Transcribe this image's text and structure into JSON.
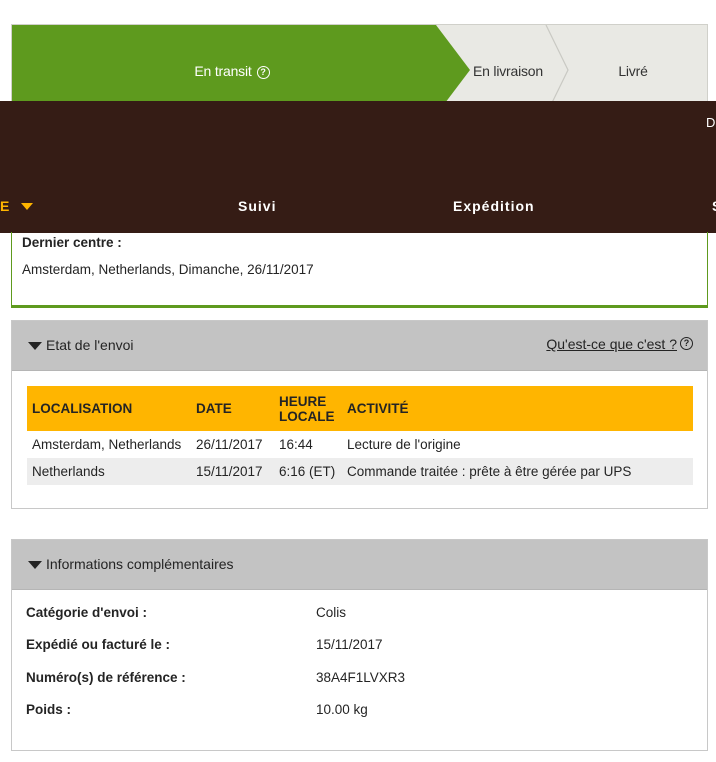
{
  "progress": {
    "steps": [
      {
        "label": "En transit",
        "help": "?"
      },
      {
        "label": "En livraison"
      },
      {
        "label": "Livré"
      }
    ],
    "colors": {
      "active": "#5e9a1e",
      "inactive": "#e9e9e4"
    }
  },
  "nav": {
    "left_label": "E",
    "corner_label": "D",
    "items": [
      "Suivi",
      "Expédition"
    ],
    "right_partial": "S",
    "bg_color": "#351c15",
    "accent_color": "#ffb500"
  },
  "summary": {
    "last_center_label": "Dernier centre :",
    "last_center_value": "Amsterdam, Netherlands, Dimanche, 26/11/2017"
  },
  "status_panel": {
    "title": "Etat de l'envoi",
    "help_link": "Qu'est-ce que c'est ?",
    "help_icon": "?",
    "columns": [
      "LOCALISATION",
      "DATE",
      "HEURE LOCALE",
      "ACTIVITÉ"
    ],
    "rows": [
      [
        "Amsterdam, Netherlands",
        "26/11/2017",
        "16:44",
        "Lecture de l'origine"
      ],
      [
        "Netherlands",
        "15/11/2017",
        "6:16 (ET)",
        "Commande traitée : prête à être gérée par UPS"
      ]
    ]
  },
  "info_panel": {
    "title": "Informations complémentaires",
    "rows": [
      {
        "key": "Catégorie d'envoi :",
        "value": "Colis"
      },
      {
        "key": "Expédié ou facturé le :",
        "value": "15/11/2017"
      },
      {
        "key": "Numéro(s) de référence :",
        "value": "38A4F1LVXR3"
      },
      {
        "key": "Poids :",
        "value": "10.00 kg"
      }
    ]
  }
}
